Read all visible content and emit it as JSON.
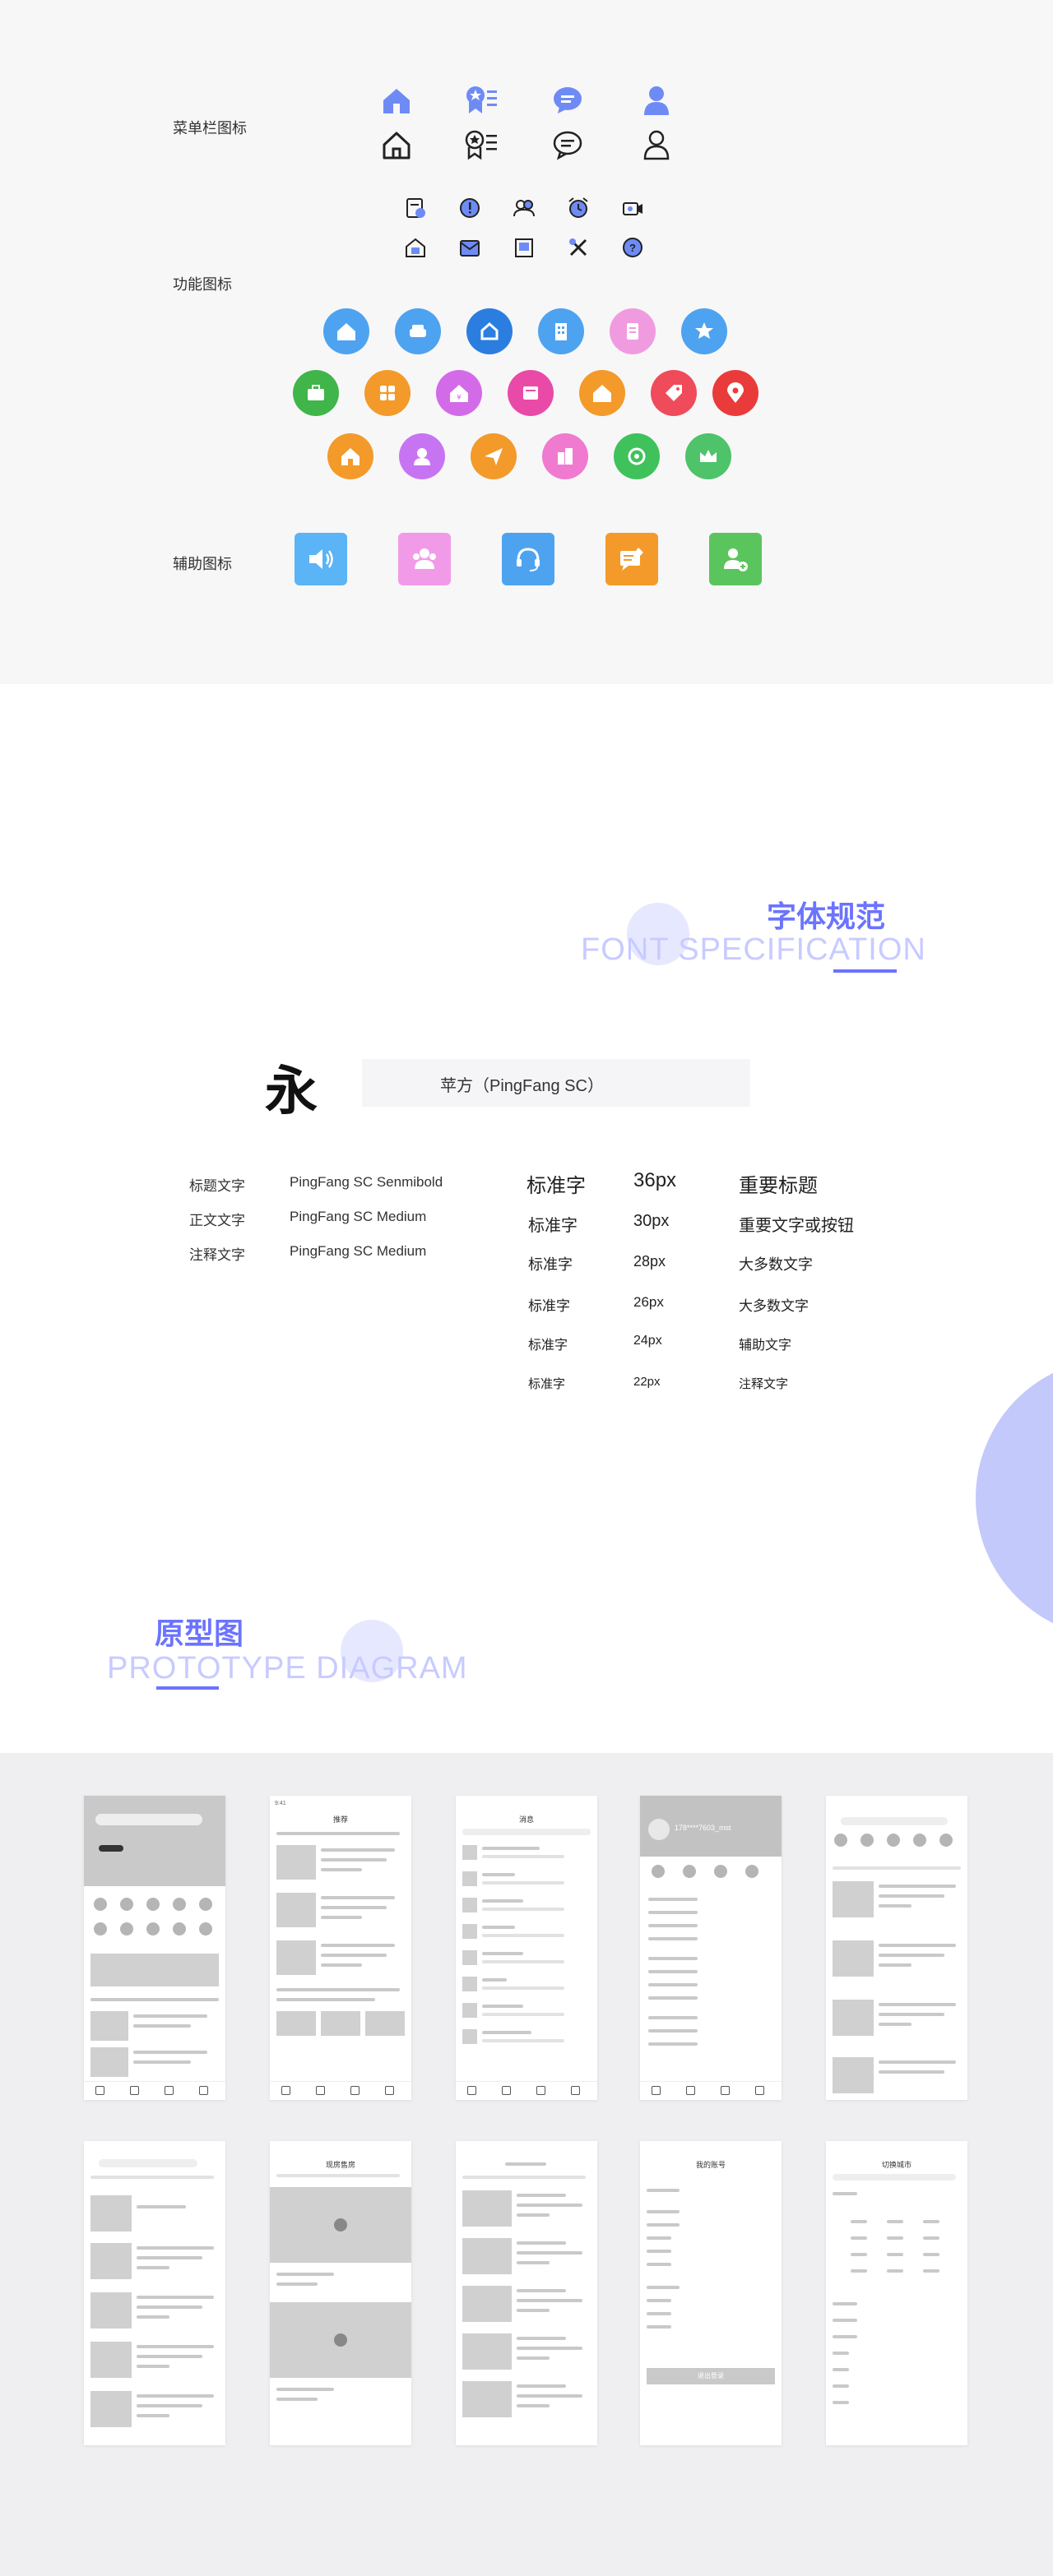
{
  "icons_section": {
    "menu_label": "菜单栏图标",
    "function_label": "功能图标",
    "aux_label": "辅助图标",
    "menu_icons": [
      "home-icon",
      "star-list-icon",
      "chat-icon",
      "user-icon"
    ],
    "function_circle_colors": {
      "row1": [
        "#4ea3f0",
        "#4ea3f0",
        "#2b7ee0",
        "#4ea3f0",
        "#f09be0",
        "#4ea3f0"
      ],
      "row2": [
        "#3fb54a",
        "#f39a2a",
        "#d36be8",
        "#e94aa8",
        "#f39a2a",
        "#f04b5b",
        "#ea3b3b"
      ],
      "row3": [
        "#f39a2a",
        "#c774f3",
        "#f39a2a",
        "#f07ad0",
        "#3fc25b",
        "#4ec36a"
      ]
    },
    "aux_colors": [
      "#5ab4f5",
      "#f19be8",
      "#4ea3f0",
      "#f39a2a",
      "#5bc55d"
    ]
  },
  "font_section": {
    "title": "字体规范",
    "subtitle": "FONT SPECIFICATION",
    "sample_char": "永",
    "font_name": "苹方（PingFang SC）",
    "usage": [
      {
        "label": "标题文字",
        "font": "PingFang SC Senmibold"
      },
      {
        "label": "正文文字",
        "font": "PingFang SC Medium"
      },
      {
        "label": "注释文字",
        "font": "PingFang SC Medium"
      }
    ],
    "sizes": [
      {
        "name": "标准字",
        "size": "36px",
        "use": "重要标题"
      },
      {
        "name": "标准字",
        "size": "30px",
        "use": "重要文字或按钮"
      },
      {
        "name": "标准字",
        "size": "28px",
        "use": "大多数文字"
      },
      {
        "name": "标准字",
        "size": "26px",
        "use": "大多数文字"
      },
      {
        "name": "标准字",
        "size": "24px",
        "use": "辅助文字"
      },
      {
        "name": "标准字",
        "size": "22px",
        "use": "注释文字"
      }
    ]
  },
  "prototype_section": {
    "title": "原型图",
    "subtitle": "PROTOTYPE DIAGRAM",
    "screens_row1": [
      {
        "title": ""
      },
      {
        "title": "推荐"
      },
      {
        "title": "消息"
      },
      {
        "title": "178****7603_mst"
      },
      {
        "title": ""
      }
    ],
    "screens_row2": [
      {
        "title": ""
      },
      {
        "title": "现房售房"
      },
      {
        "title": ""
      },
      {
        "title": "我的账号"
      },
      {
        "title": "切换城市"
      }
    ],
    "phone_time": "9:41",
    "logout": "退出登录"
  }
}
